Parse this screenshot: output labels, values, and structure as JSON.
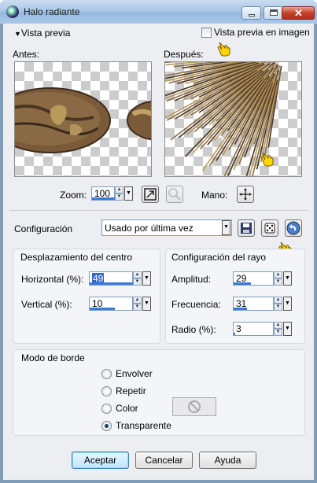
{
  "window": {
    "title": "Halo radiante"
  },
  "preview": {
    "toggle_label": "Vista previa",
    "live_preview_label": "Vista previa en imagen",
    "before_label": "Antes:",
    "after_label": "Después:",
    "zoom_label": "Zoom:",
    "zoom_value": "100",
    "pan_label": "Mano:"
  },
  "settings": {
    "label": "Configuración",
    "preset_value": "Usado por última vez"
  },
  "center_offset": {
    "title": "Desplazamiento del centro",
    "horizontal_label": "Horizontal (%):",
    "horizontal_value": "49",
    "vertical_label": "Vertical (%):",
    "vertical_value": "10"
  },
  "ray_settings": {
    "title": "Configuración del rayo",
    "amplitude_label": "Amplitud:",
    "amplitude_value": "29",
    "frequency_label": "Frecuencia:",
    "frequency_value": "31",
    "radius_label": "Radio (%):",
    "radius_value": "3"
  },
  "edge_mode": {
    "title": "Modo de borde",
    "options": [
      "Envolver",
      "Repetir",
      "Color",
      "Transparente"
    ],
    "selected": "Transparente"
  },
  "footer": {
    "ok": "Aceptar",
    "cancel": "Cancelar",
    "help": "Ayuda"
  },
  "colors": {
    "accent": "#3a7bd5",
    "selection": "#3366cc"
  }
}
